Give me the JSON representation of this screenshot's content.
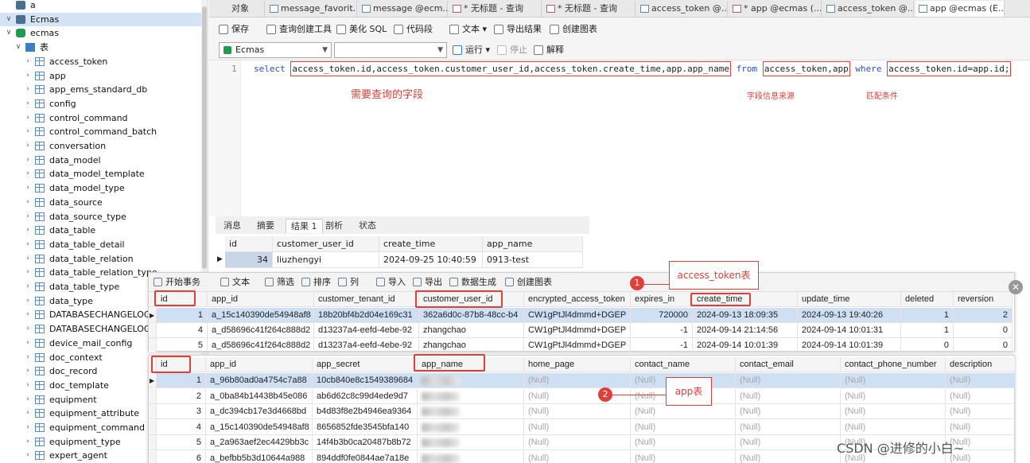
{
  "tree": {
    "items": [
      {
        "label": "a",
        "kind": "conn",
        "level": 0,
        "arrow": ""
      },
      {
        "label": "Ecmas",
        "kind": "conn",
        "level": 0,
        "arrow": "expanded",
        "selected": true
      },
      {
        "label": "ecmas",
        "kind": "db",
        "level": 1,
        "arrow": "expanded"
      },
      {
        "label": "表",
        "kind": "tables",
        "level": 2,
        "arrow": "expanded"
      },
      {
        "label": "access_token",
        "kind": "table",
        "level": 3,
        "arrow": "collapsed"
      },
      {
        "label": "app",
        "kind": "table",
        "level": 3,
        "arrow": "collapsed"
      },
      {
        "label": "app_ems_standard_db",
        "kind": "table",
        "level": 3,
        "arrow": "collapsed"
      },
      {
        "label": "config",
        "kind": "table",
        "level": 3,
        "arrow": "collapsed"
      },
      {
        "label": "control_command",
        "kind": "table",
        "level": 3,
        "arrow": "collapsed"
      },
      {
        "label": "control_command_batch",
        "kind": "table",
        "level": 3,
        "arrow": "collapsed"
      },
      {
        "label": "conversation",
        "kind": "table",
        "level": 3,
        "arrow": "collapsed"
      },
      {
        "label": "data_model",
        "kind": "table",
        "level": 3,
        "arrow": "collapsed"
      },
      {
        "label": "data_model_template",
        "kind": "table",
        "level": 3,
        "arrow": "collapsed"
      },
      {
        "label": "data_model_type",
        "kind": "table",
        "level": 3,
        "arrow": "collapsed"
      },
      {
        "label": "data_source",
        "kind": "table",
        "level": 3,
        "arrow": "collapsed"
      },
      {
        "label": "data_source_type",
        "kind": "table",
        "level": 3,
        "arrow": "collapsed"
      },
      {
        "label": "data_table",
        "kind": "table",
        "level": 3,
        "arrow": "collapsed"
      },
      {
        "label": "data_table_detail",
        "kind": "table",
        "level": 3,
        "arrow": "collapsed"
      },
      {
        "label": "data_table_relation",
        "kind": "table",
        "level": 3,
        "arrow": "collapsed"
      },
      {
        "label": "data_table_relation_type",
        "kind": "table",
        "level": 3,
        "arrow": "collapsed"
      },
      {
        "label": "data_table_type",
        "kind": "table",
        "level": 3,
        "arrow": "collapsed"
      },
      {
        "label": "data_type",
        "kind": "table",
        "level": 3,
        "arrow": "collapsed"
      },
      {
        "label": "DATABASECHANGELOG",
        "kind": "table",
        "level": 3,
        "arrow": "collapsed"
      },
      {
        "label": "DATABASECHANGELOGLOCK",
        "kind": "table",
        "level": 3,
        "arrow": "collapsed"
      },
      {
        "label": "device_mail_config",
        "kind": "table",
        "level": 3,
        "arrow": "collapsed"
      },
      {
        "label": "doc_context",
        "kind": "table",
        "level": 3,
        "arrow": "collapsed"
      },
      {
        "label": "doc_record",
        "kind": "table",
        "level": 3,
        "arrow": "collapsed"
      },
      {
        "label": "doc_template",
        "kind": "table",
        "level": 3,
        "arrow": "collapsed"
      },
      {
        "label": "equipment",
        "kind": "table",
        "level": 3,
        "arrow": "collapsed"
      },
      {
        "label": "equipment_attribute",
        "kind": "table",
        "level": 3,
        "arrow": "collapsed"
      },
      {
        "label": "equipment_command",
        "kind": "table",
        "level": 3,
        "arrow": "collapsed"
      },
      {
        "label": "equipment_type",
        "kind": "table",
        "level": 3,
        "arrow": "collapsed"
      },
      {
        "label": "expert_agent",
        "kind": "table",
        "level": 3,
        "arrow": "collapsed"
      }
    ]
  },
  "tabs": [
    {
      "label": "对象",
      "icon": "none"
    },
    {
      "label": "message_favorit...",
      "icon": "table"
    },
    {
      "label": "message @ecm...",
      "icon": "table"
    },
    {
      "label": "* 无标题 - 查询",
      "icon": "query"
    },
    {
      "label": "* 无标题 - 查询",
      "icon": "query"
    },
    {
      "label": "access_token @...",
      "icon": "table"
    },
    {
      "label": "* app @ecmas (...",
      "icon": "query"
    },
    {
      "label": "access_token @...",
      "icon": "table"
    },
    {
      "label": "app @ecmas (E...",
      "icon": "table"
    }
  ],
  "toolbar": {
    "save": "保存",
    "query_builder": "查询创建工具",
    "beautify": "美化 SQL",
    "snippet": "代码段",
    "text": "文本",
    "export": "导出结果",
    "chart": "创建图表",
    "connection": "Ecmas",
    "run": "运行",
    "stop": "停止",
    "explain": "解释"
  },
  "editor": {
    "line_number": "1",
    "kw_select": "select",
    "fields": "access_token.id,access_token.customer_user_id,access_token.create_time,app.app_name",
    "kw_from": "from",
    "source": "access_token,app",
    "kw_where": "where",
    "condition": "access_token.id=app.id;",
    "anno_fields": "需要查询的字段",
    "anno_source": "字段信息来源",
    "anno_condition": "匹配条件"
  },
  "result_tabs": [
    "消息",
    "摘要",
    "结果 1",
    "剖析",
    "状态"
  ],
  "result": {
    "columns": [
      "id",
      "customer_user_id",
      "create_time",
      "app_name"
    ],
    "rows": [
      [
        "34",
        "liuzhengyi",
        "2024-09-25 10:40:59",
        "0913-test"
      ]
    ]
  },
  "access_view": {
    "tools": [
      "开始事务",
      "文本",
      "筛选",
      "排序",
      "列",
      "导入",
      "导出",
      "数据生成",
      "创建图表"
    ],
    "columns": [
      "id",
      "app_id",
      "customer_tenant_id",
      "customer_user_id",
      "encrypted_access_token",
      "expires_in",
      "create_time",
      "update_time",
      "deleted",
      "reversion"
    ],
    "rows": [
      [
        "1",
        "a_15c140390de54948af8",
        "18b20bf4b2d04e169c31",
        "362a6d0c-87b8-48cc-b4",
        "CW1gPtJl4dmmd+DGEP",
        "720000",
        "2024-09-13 18:09:35",
        "2024-09-13 19:40:26",
        "1",
        "2"
      ],
      [
        "4",
        "a_d58696c41f264c888d2",
        "d13237a4-eefd-4ebe-92",
        "zhangchao",
        "CW1gPtJl4dmmd+DGEP",
        "-1",
        "2024-09-14 21:14:56",
        "2024-09-14 10:01:31",
        "1",
        "0"
      ],
      [
        "5",
        "a_d58696c41f264c888d2",
        "d13237a4-eefd-4ebe-92",
        "zhangchao",
        "CW1gPtJl4dmmd+DGEP",
        "-1",
        "2024-09-14 10:01:39",
        "2024-09-14 10:01:39",
        "0",
        "0"
      ]
    ],
    "callout": "access_token表",
    "badge": "1"
  },
  "app_view": {
    "columns": [
      "id",
      "app_id",
      "app_secret",
      "app_name",
      "home_page",
      "contact_name",
      "contact_email",
      "contact_phone_number",
      "description"
    ],
    "rows": [
      [
        "1",
        "a_96b80ad0a4754c7a88",
        "10cb840e8c1549389684",
        "",
        "(Null)",
        "(Null)",
        "(Null)",
        "(Null)",
        "(Null)"
      ],
      [
        "2",
        "a_0ba84b14438b45e086",
        "ab6d62c8c99d4ede9d7",
        "",
        "(Null)",
        "(Null)",
        "(Null)",
        "(Null)",
        "(Null)"
      ],
      [
        "3",
        "a_dc394cb17e3d4668bd",
        "b4d83f8e2b4946ea9364",
        "",
        "(Null)",
        "(Null)",
        "(Null)",
        "(Null)",
        "(Null)"
      ],
      [
        "4",
        "a_15c140390de54948af8",
        "8656852fde3545bfa140",
        "",
        "(Null)",
        "(Null)",
        "(Null)",
        "(Null)",
        "(Null)"
      ],
      [
        "5",
        "a_2a963aef2ec4429bb3c",
        "14f4b3b0ca20487b8b72",
        "",
        "(Null)",
        "(Null)",
        "(Null)",
        "(Null)",
        "(Null)"
      ],
      [
        "6",
        "a_befbb5b3d10644a988",
        "894ddf0fe0844ae7a18e",
        "",
        "(Null)",
        "(Null)",
        "(Null)",
        "(Null)",
        "(Null)"
      ]
    ],
    "callout": "app表",
    "badge": "2"
  },
  "watermark": "CSDN @进修的小白~",
  "colors": {
    "accent_red": "#e0403a",
    "keyword_blue": "#2a4ecf",
    "selection": "#cfe0f5"
  }
}
